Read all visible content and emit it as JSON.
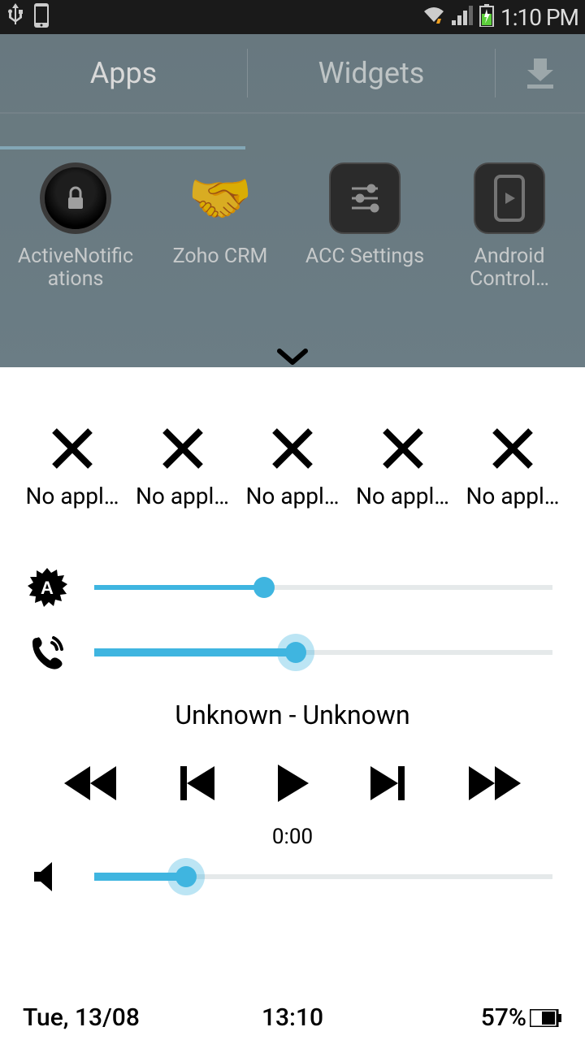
{
  "status": {
    "time": "1:10 PM"
  },
  "drawer": {
    "tabs": {
      "apps": "Apps",
      "widgets": "Widgets"
    },
    "apps": [
      {
        "label": "ActiveNotific\nations"
      },
      {
        "label": "Zoho CRM"
      },
      {
        "label": "ACC Settings"
      },
      {
        "label": "Android\nControl…"
      }
    ]
  },
  "panel": {
    "quick": [
      {
        "label": "No appl…"
      },
      {
        "label": "No appl…"
      },
      {
        "label": "No appl…"
      },
      {
        "label": "No appl…"
      },
      {
        "label": "No appl…"
      }
    ],
    "sliders": {
      "brightness_percent": 37,
      "ringer_percent": 44,
      "media_volume_percent": 20
    },
    "media": {
      "title": "Unknown - Unknown",
      "time": "0:00"
    },
    "footer": {
      "date": "Tue, 13/08",
      "time": "13:10",
      "battery": "57%"
    }
  }
}
